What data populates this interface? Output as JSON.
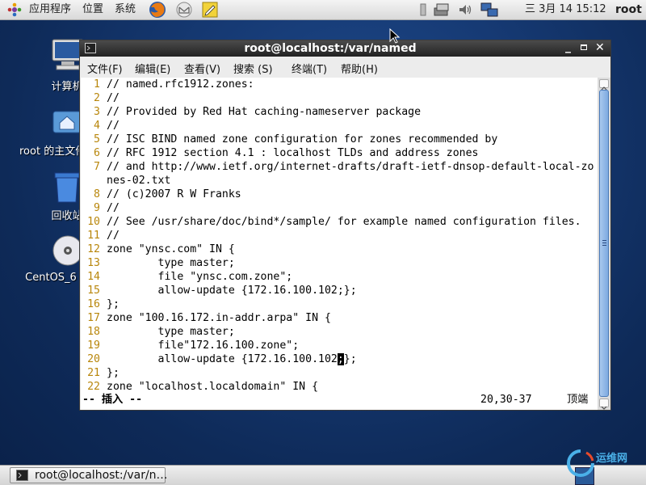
{
  "top_panel": {
    "menus": [
      "应用程序",
      "位置",
      "系统"
    ],
    "clock": "三 3月 14 15:12",
    "user": "root"
  },
  "desktop": {
    "icons": [
      {
        "label": "计算机"
      },
      {
        "label": "root 的主文件夹"
      },
      {
        "label": "回收站"
      },
      {
        "label": "CentOS_6"
      }
    ]
  },
  "window": {
    "title": "root@localhost:/var/named",
    "menus": [
      "文件(F)",
      "编辑(E)",
      "查看(V)",
      "搜索 (S)",
      "终端(T)",
      "帮助(H)"
    ],
    "lines": [
      {
        "n": "1",
        "t": "// named.rfc1912.zones:"
      },
      {
        "n": "2",
        "t": "//"
      },
      {
        "n": "3",
        "t": "// Provided by Red Hat caching-nameserver package"
      },
      {
        "n": "4",
        "t": "//"
      },
      {
        "n": "5",
        "t": "// ISC BIND named zone configuration for zones recommended by"
      },
      {
        "n": "6",
        "t": "// RFC 1912 section 4.1 : localhost TLDs and address zones"
      },
      {
        "n": "7",
        "t": "// and http://www.ietf.org/internet-drafts/draft-ietf-dnsop-default-local-zo"
      },
      {
        "n": "",
        "t": "nes-02.txt"
      },
      {
        "n": "8",
        "t": "// (c)2007 R W Franks"
      },
      {
        "n": "9",
        "t": "//"
      },
      {
        "n": "10",
        "t": "// See /usr/share/doc/bind*/sample/ for example named configuration files."
      },
      {
        "n": "11",
        "t": "//"
      },
      {
        "n": "12",
        "t": "zone \"ynsc.com\" IN {"
      },
      {
        "n": "13",
        "t": "        type master;"
      },
      {
        "n": "14",
        "t": "        file \"ynsc.com.zone\";"
      },
      {
        "n": "15",
        "t": "        allow-update {172.16.100.102;};"
      },
      {
        "n": "16",
        "t": "};"
      },
      {
        "n": "17",
        "t": "zone \"100.16.172.in-addr.arpa\" IN {"
      },
      {
        "n": "18",
        "t": "        type master;"
      },
      {
        "n": "19",
        "t": "        file\"172.16.100.zone\";"
      },
      {
        "n": "20",
        "t": "        allow-update {172.16.100.102",
        "cursor": ";",
        "after": "};"
      },
      {
        "n": "21",
        "t": "};"
      },
      {
        "n": "22",
        "t": "zone \"localhost.localdomain\" IN {"
      }
    ],
    "status_mode": "-- 插入 --",
    "status_pos": "20,30-37",
    "status_scroll": "顶端"
  },
  "taskbar": {
    "task_label": "root@localhost:/var/n…"
  },
  "watermark": "运维网"
}
